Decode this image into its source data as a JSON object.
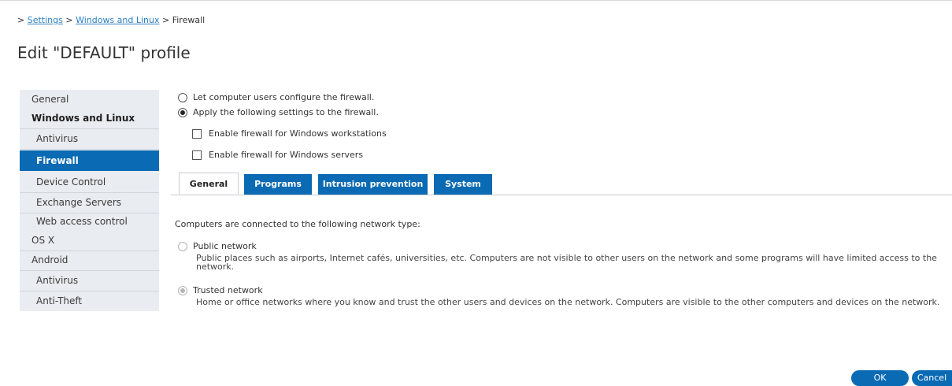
{
  "breadcrumb": {
    "prefix": ">",
    "items": [
      {
        "label": "Settings"
      },
      {
        "label": "Windows and Linux"
      },
      {
        "label": "Firewall"
      }
    ],
    "separator": ">"
  },
  "page_title": "Edit \"DEFAULT\" profile",
  "sidebar": {
    "items": [
      {
        "label": "General"
      },
      {
        "label": "Windows and Linux"
      },
      {
        "label": "Antivirus"
      },
      {
        "label": "Firewall"
      },
      {
        "label": "Device Control"
      },
      {
        "label": "Exchange Servers"
      },
      {
        "label": "Web access control"
      },
      {
        "label": "OS X"
      },
      {
        "label": "Android"
      },
      {
        "label": "Antivirus"
      },
      {
        "label": "Anti-Theft"
      }
    ],
    "active_item": "Firewall"
  },
  "firewall_mode": {
    "options": [
      {
        "label": "Let computer users configure the firewall.",
        "checked": false
      },
      {
        "label": "Apply the following settings to the firewall.",
        "checked": true
      }
    ]
  },
  "checkboxes": [
    {
      "label": "Enable firewall for Windows workstations",
      "checked": false
    },
    {
      "label": "Enable firewall for Windows servers",
      "checked": false
    }
  ],
  "tabs": [
    {
      "label": "General",
      "active": true
    },
    {
      "label": "Programs",
      "active": false
    },
    {
      "label": "Intrusion prevention",
      "active": false
    },
    {
      "label": "System",
      "active": false
    }
  ],
  "network": {
    "label": "Computers are connected to the following network type:",
    "options": [
      {
        "title": "Public network",
        "description": "Public places such as airports, Internet cafés, universities, etc. Computers are not visible to other users on the network and some programs will have limited access to the network.",
        "checked": false
      },
      {
        "title": "Trusted network",
        "description": "Home or office networks where you know and trust the other users and devices on the network. Computers are visible to the other computers and devices on the network.",
        "checked": true
      }
    ]
  },
  "buttons": {
    "ok": "OK",
    "cancel": "Cancel"
  },
  "colors": {
    "accent": "#0a6ab3",
    "link": "#2d7fc1",
    "sidebar_bg": "#e9ecf0"
  }
}
